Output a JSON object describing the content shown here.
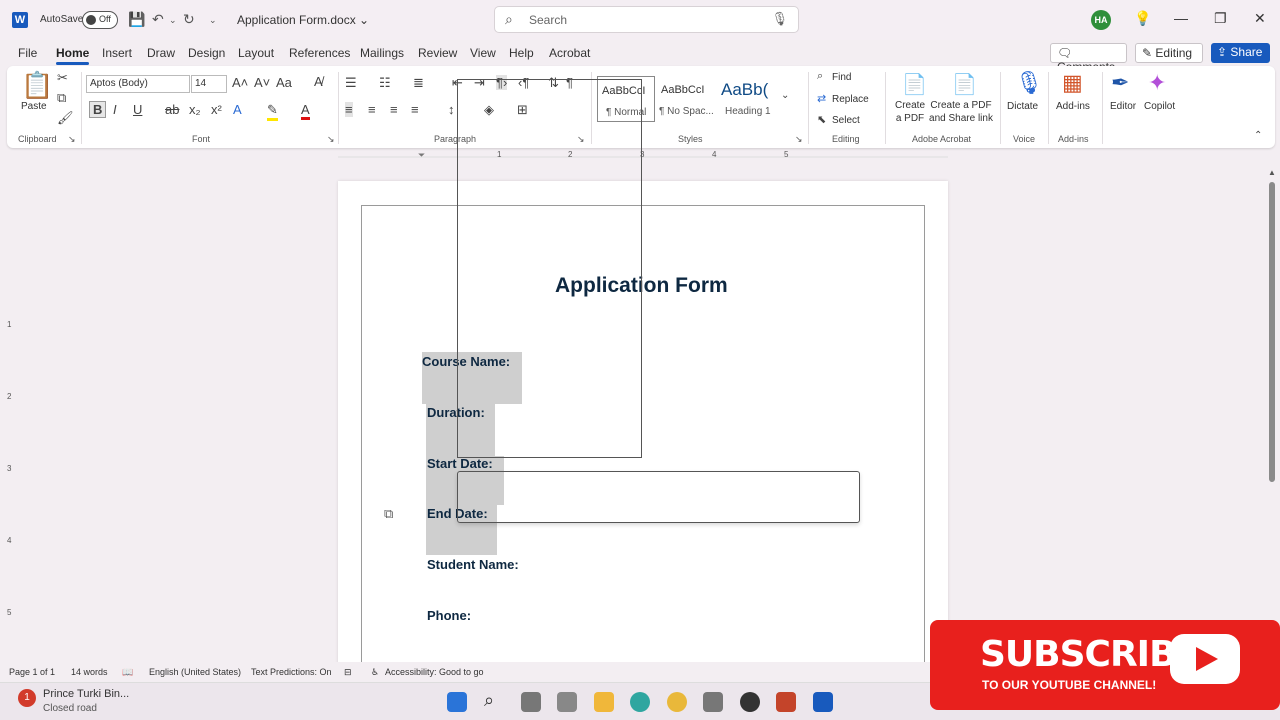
{
  "titlebar": {
    "app_icon": "W",
    "autosave_label": "AutoSave",
    "autosave_state": "Off",
    "doc_title": "Application Form.docx",
    "search_placeholder": "Search",
    "avatar_initials": "HA"
  },
  "tabs": [
    "File",
    "Home",
    "Insert",
    "Draw",
    "Design",
    "Layout",
    "References",
    "Mailings",
    "Review",
    "View",
    "Help",
    "Acrobat"
  ],
  "active_tab": "Home",
  "top_right": {
    "comments": "Comments",
    "editing": "Editing",
    "share": "Share"
  },
  "ribbon": {
    "clipboard": {
      "paste": "Paste",
      "group": "Clipboard"
    },
    "font": {
      "name": "Aptos (Body)",
      "size": "14",
      "group": "Font"
    },
    "paragraph": {
      "group": "Paragraph"
    },
    "styles": {
      "group": "Styles",
      "items": [
        {
          "preview": "AaBbCcI",
          "name": "¶ Normal"
        },
        {
          "preview": "AaBbCcI",
          "name": "¶ No Spac..."
        },
        {
          "preview": "AaBb(",
          "name": "Heading 1"
        }
      ]
    },
    "editing": {
      "find": "Find",
      "replace": "Replace",
      "select": "Select",
      "group": "Editing"
    },
    "acrobat": {
      "create_pdf": "Create a PDF",
      "create_share": "Create a PDF and Share link",
      "group": "Adobe Acrobat"
    },
    "voice": {
      "dictate": "Dictate",
      "group": "Voice"
    },
    "addins": {
      "addins": "Add-ins",
      "group": "Add-ins"
    },
    "editor": "Editor",
    "copilot": "Copilot"
  },
  "ruler_numbers": [
    "1",
    "2",
    "3",
    "4",
    "5"
  ],
  "vruler_numbers": [
    "1",
    "2",
    "3",
    "4",
    "5"
  ],
  "document": {
    "title": "Application Form",
    "fields": [
      "Course Name:",
      "Duration:",
      "Start Date:",
      "End Date:",
      "Student Name:",
      "Phone:"
    ]
  },
  "statusbar": {
    "page": "Page 1 of 1",
    "words": "14 words",
    "language": "English (United States)",
    "predictions": "Text Predictions: On",
    "accessibility": "Accessibility: Good to go"
  },
  "taskbar": {
    "notif_title": "Prince Turki Bin...",
    "notif_sub": "Closed road",
    "notif_badge": "1"
  },
  "banner": {
    "big": "SUBSCRIBE",
    "small": "TO OUR YOUTUBE CHANNEL!"
  },
  "colors": {
    "accent": "#185abd",
    "heading": "#0e2841",
    "banner": "#e8201d"
  }
}
